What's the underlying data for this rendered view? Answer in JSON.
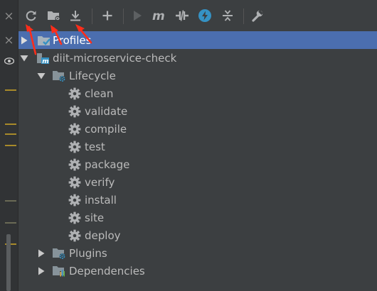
{
  "tree": {
    "profiles": "Profiles",
    "project": "diit-microservice-check",
    "lifecycle": "Lifecycle",
    "phases": [
      "clean",
      "validate",
      "compile",
      "test",
      "package",
      "verify",
      "install",
      "site",
      "deploy"
    ],
    "plugins": "Plugins",
    "dependencies": "Dependencies"
  },
  "gutter": {
    "close_glyph": "×"
  },
  "colors": {
    "selection": "#4b6eaf",
    "background": "#3c3f41",
    "icon": "#afb1b3",
    "folder": "#87939a",
    "maven_badge": "#3592c4",
    "annotation_arrow": "#ff2d1a"
  }
}
